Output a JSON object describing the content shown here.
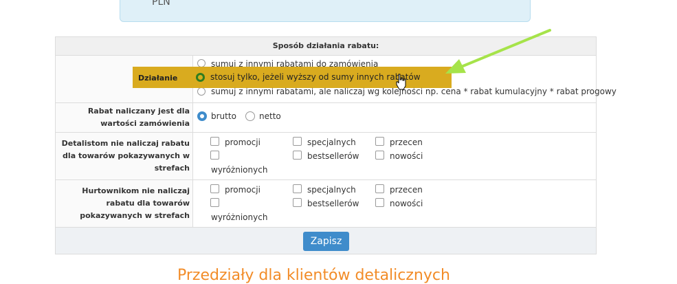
{
  "info_box": {
    "text": "PLN"
  },
  "settings": {
    "title": "Sposób działania rabatu:",
    "action": {
      "label": "Działanie",
      "options": [
        "sumuj z innymi rabatami do zamówienia",
        "stosuj tylko, jeżeli wyższy od sumy innych rabatów",
        "sumuj z innymi rabatami, ale naliczaj wg kolejności np. cena * rabat kumulacyjny * rabat progowy"
      ],
      "selected_index": 1
    },
    "value_basis": {
      "label": "Rabat naliczany jest dla wartości zamówienia",
      "options": [
        "brutto",
        "netto"
      ],
      "selected_index": 0
    },
    "retail_exclude": {
      "label": "Detalistom nie naliczaj rabatu dla towarów pokazywanych w strefach",
      "options": [
        "promocji",
        "specjalnych",
        "przecen",
        "wyróżnionych",
        "bestsellerów",
        "nowości"
      ]
    },
    "wholesale_exclude": {
      "label": "Hurtownikom nie naliczaj rabatu dla towarów pokazywanych w strefach",
      "options": [
        "promocji",
        "specjalnych",
        "przecen",
        "wyróżnionych",
        "bestsellerów",
        "nowości"
      ]
    },
    "save_label": "Zapisz"
  },
  "section_title": "Przedziały dla klientów detalicznych",
  "colors": {
    "accent": "#3f8ccb",
    "highlight": "#d9ab1f",
    "arrow": "#a6e34a",
    "title": "#f28c28"
  },
  "icons": [
    "hand-cursor-icon",
    "pointer-arrow-icon"
  ]
}
